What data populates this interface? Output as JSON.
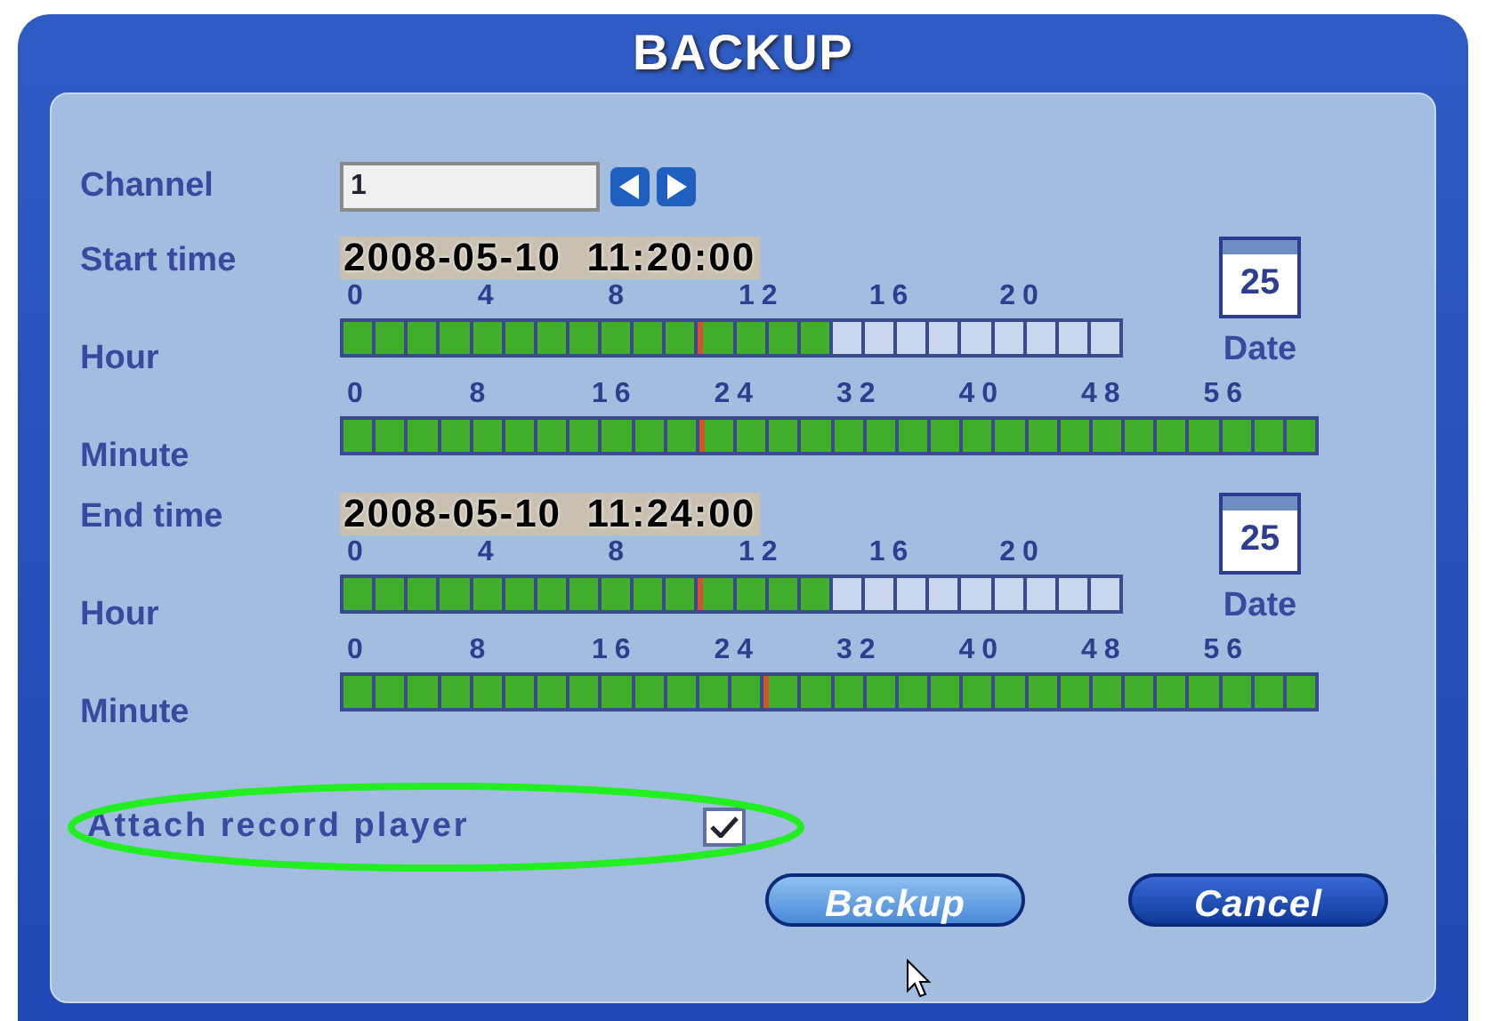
{
  "window": {
    "title": "BACKUP"
  },
  "channel": {
    "label": "Channel",
    "value": "1"
  },
  "sections": [
    {
      "label": "Start time",
      "datetime": "2008-05-10  11:20:00",
      "date_label": "Date",
      "calendar_day": "25",
      "hour": {
        "label": "Hour",
        "ticks": [
          "0",
          "4",
          "8",
          "12",
          "16",
          "20"
        ],
        "cells": [
          {
            "kind": "filled"
          },
          {
            "kind": "filled"
          },
          {
            "kind": "filled"
          },
          {
            "kind": "filled"
          },
          {
            "kind": "filled"
          },
          {
            "kind": "filled"
          },
          {
            "kind": "filled"
          },
          {
            "kind": "filled"
          },
          {
            "kind": "filled"
          },
          {
            "kind": "filled"
          },
          {
            "kind": "filled"
          },
          {
            "kind": "marked"
          },
          {
            "kind": "filled"
          },
          {
            "kind": "filled"
          },
          {
            "kind": "filled"
          },
          {
            "kind": "empty"
          },
          {
            "kind": "empty"
          },
          {
            "kind": "empty"
          },
          {
            "kind": "empty"
          },
          {
            "kind": "empty"
          },
          {
            "kind": "empty"
          },
          {
            "kind": "empty"
          },
          {
            "kind": "empty"
          },
          {
            "kind": "empty"
          }
        ]
      },
      "minute": {
        "label": "Minute",
        "ticks": [
          "0",
          "8",
          "16",
          "24",
          "32",
          "40",
          "48",
          "56"
        ],
        "cells": [
          {
            "kind": "filled"
          },
          {
            "kind": "filled"
          },
          {
            "kind": "filled"
          },
          {
            "kind": "filled"
          },
          {
            "kind": "filled"
          },
          {
            "kind": "filled"
          },
          {
            "kind": "filled"
          },
          {
            "kind": "filled"
          },
          {
            "kind": "filled"
          },
          {
            "kind": "filled"
          },
          {
            "kind": "filled"
          },
          {
            "kind": "marked"
          },
          {
            "kind": "filled"
          },
          {
            "kind": "filled"
          },
          {
            "kind": "filled"
          },
          {
            "kind": "filled"
          },
          {
            "kind": "filled"
          },
          {
            "kind": "filled"
          },
          {
            "kind": "filled"
          },
          {
            "kind": "filled"
          },
          {
            "kind": "filled"
          },
          {
            "kind": "filled"
          },
          {
            "kind": "filled"
          },
          {
            "kind": "filled"
          },
          {
            "kind": "filled"
          },
          {
            "kind": "filled"
          },
          {
            "kind": "filled"
          },
          {
            "kind": "filled"
          },
          {
            "kind": "filled"
          },
          {
            "kind": "filled"
          }
        ]
      }
    },
    {
      "label": "End time",
      "datetime": "2008-05-10  11:24:00",
      "date_label": "Date",
      "calendar_day": "25",
      "hour": {
        "label": "Hour",
        "ticks": [
          "0",
          "4",
          "8",
          "12",
          "16",
          "20"
        ],
        "cells": [
          {
            "kind": "filled"
          },
          {
            "kind": "filled"
          },
          {
            "kind": "filled"
          },
          {
            "kind": "filled"
          },
          {
            "kind": "filled"
          },
          {
            "kind": "filled"
          },
          {
            "kind": "filled"
          },
          {
            "kind": "filled"
          },
          {
            "kind": "filled"
          },
          {
            "kind": "filled"
          },
          {
            "kind": "filled"
          },
          {
            "kind": "marked"
          },
          {
            "kind": "filled"
          },
          {
            "kind": "filled"
          },
          {
            "kind": "filled"
          },
          {
            "kind": "empty"
          },
          {
            "kind": "empty"
          },
          {
            "kind": "empty"
          },
          {
            "kind": "empty"
          },
          {
            "kind": "empty"
          },
          {
            "kind": "empty"
          },
          {
            "kind": "empty"
          },
          {
            "kind": "empty"
          },
          {
            "kind": "empty"
          }
        ]
      },
      "minute": {
        "label": "Minute",
        "ticks": [
          "0",
          "8",
          "16",
          "24",
          "32",
          "40",
          "48",
          "56"
        ],
        "cells": [
          {
            "kind": "filled"
          },
          {
            "kind": "filled"
          },
          {
            "kind": "filled"
          },
          {
            "kind": "filled"
          },
          {
            "kind": "filled"
          },
          {
            "kind": "filled"
          },
          {
            "kind": "filled"
          },
          {
            "kind": "filled"
          },
          {
            "kind": "filled"
          },
          {
            "kind": "filled"
          },
          {
            "kind": "filled"
          },
          {
            "kind": "filled"
          },
          {
            "kind": "filled"
          },
          {
            "kind": "marked"
          },
          {
            "kind": "filled"
          },
          {
            "kind": "filled"
          },
          {
            "kind": "filled"
          },
          {
            "kind": "filled"
          },
          {
            "kind": "filled"
          },
          {
            "kind": "filled"
          },
          {
            "kind": "filled"
          },
          {
            "kind": "filled"
          },
          {
            "kind": "filled"
          },
          {
            "kind": "filled"
          },
          {
            "kind": "filled"
          },
          {
            "kind": "filled"
          },
          {
            "kind": "filled"
          },
          {
            "kind": "filled"
          },
          {
            "kind": "filled"
          },
          {
            "kind": "filled"
          }
        ]
      }
    }
  ],
  "attach_player": {
    "label": "Attach record player",
    "checked": true
  },
  "buttons": [
    {
      "label": "Backup",
      "selected": true
    },
    {
      "label": "Cancel",
      "selected": false
    }
  ]
}
